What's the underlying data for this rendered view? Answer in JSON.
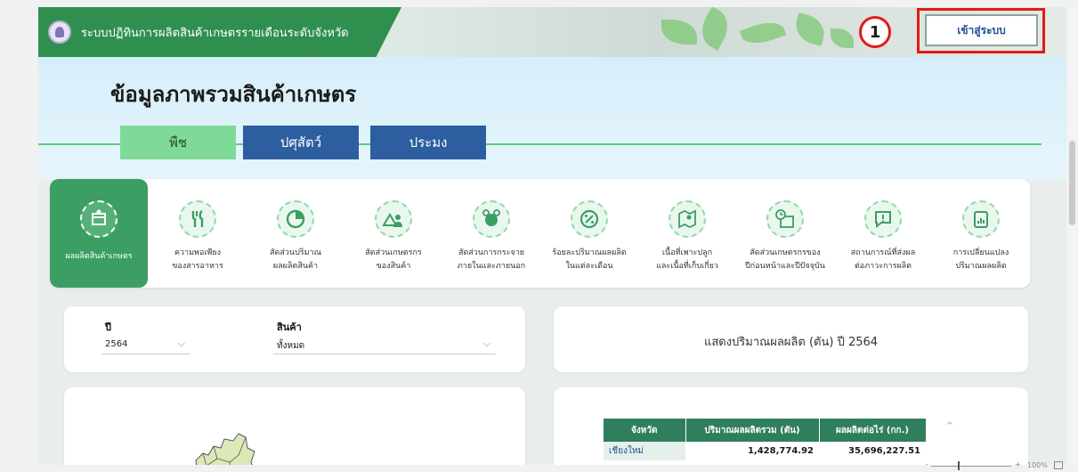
{
  "header": {
    "app_title": "ระบบปฏิทินการผลิตสินค้าเกษตรรายเดือนระดับจังหวัด",
    "login_label": "เข้าสู่ระบบ",
    "step_number": "1"
  },
  "hero": {
    "page_title": "ข้อมูลภาพรวมสินค้าเกษตร",
    "tabs": [
      {
        "label": "พืช",
        "active": true
      },
      {
        "label": "ปศุสัตว์",
        "active": false
      },
      {
        "label": "ประมง",
        "active": false
      }
    ]
  },
  "menu": {
    "items": [
      {
        "line1": "ผลผลิตสินค้าเกษตร",
        "line2": "",
        "icon": "box-hand-icon",
        "active": true
      },
      {
        "line1": "ความพอเพียง",
        "line2": "ของสารอาหาร",
        "icon": "utensils-icon",
        "active": false
      },
      {
        "line1": "สัดส่วนปริมาณ",
        "line2": "ผลผลิตสินค้า",
        "icon": "pie-chart-icon",
        "active": false
      },
      {
        "line1": "สัดส่วนเกษตรกร",
        "line2": "ของสินค้า",
        "icon": "farmer-icon",
        "active": false
      },
      {
        "line1": "สัดส่วนการกระจาย",
        "line2": "ภายในและภายนอก",
        "icon": "distribution-icon",
        "active": false
      },
      {
        "line1": "ร้อยละปริมาณผลผลิต",
        "line2": "ในแต่ละเดือน",
        "icon": "percent-icon",
        "active": false
      },
      {
        "line1": "เนื้อที่เพาะปลูก",
        "line2": "และเนื้อที่เก็บเกี่ยว",
        "icon": "map-pin-icon",
        "active": false
      },
      {
        "line1": "สัดส่วนเกษตรกรของ",
        "line2": "ปีก่อนหน้าและปีปัจจุบัน",
        "icon": "calendar-clock-icon",
        "active": false
      },
      {
        "line1": "สถานการณ์ที่ส่งผล",
        "line2": "ต่อภาวะการผลิต",
        "icon": "alert-message-icon",
        "active": false
      },
      {
        "line1": "การเปลี่ยนแปลง",
        "line2": "ปริมาณผลผลิต",
        "icon": "report-chart-icon",
        "active": false
      }
    ]
  },
  "filters": {
    "year_label": "ปี",
    "year_value": "2564",
    "product_label": "สินค้า",
    "product_value": "ทั้งหมด"
  },
  "summary": {
    "title": "แสดงปริมาณผลผลิต (ตัน) ปี 2564"
  },
  "table": {
    "headers": [
      "จังหวัด",
      "ปริมาณผลผลิตรวม (ตัน)",
      "ผลผลิตต่อไร่ (กก.)"
    ],
    "rows": [
      [
        "เชียงใหม่",
        "1,428,774.92",
        "35,696,227.51"
      ]
    ]
  },
  "zoom": {
    "level": "100%"
  },
  "colors": {
    "brand_green": "#2f8f4f",
    "tab_blue": "#2c5ea0",
    "highlight_red": "#e11b1b"
  }
}
